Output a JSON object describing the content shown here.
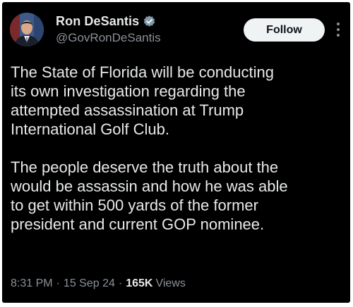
{
  "tweet": {
    "author": {
      "display_name": "Ron DeSantis",
      "handle": "@GovRonDeSantis",
      "verified_icon": "verified-badge-icon",
      "avatar_icon": "avatar-portrait"
    },
    "follow_label": "Follow",
    "more_icon": "more-options-icon",
    "paragraphs": [
      "The State of Florida will be conducting\nits own investigation regarding the\nattempted assassination at Trump\nInternational Golf Club.",
      "The people deserve the truth about the\nwould be assassin and how he was able\nto get within 500 yards of the former\npresident and current GOP nominee."
    ],
    "time": "8:31 PM",
    "separator": "·",
    "date": "15 Sep 24",
    "views_count": "165K",
    "views_label": "Views"
  },
  "colors": {
    "background": "#000000",
    "text": "#e7e9ea",
    "muted": "#8b9198",
    "follow_bg": "#eff3f4",
    "verified_badge": "#829aab"
  }
}
